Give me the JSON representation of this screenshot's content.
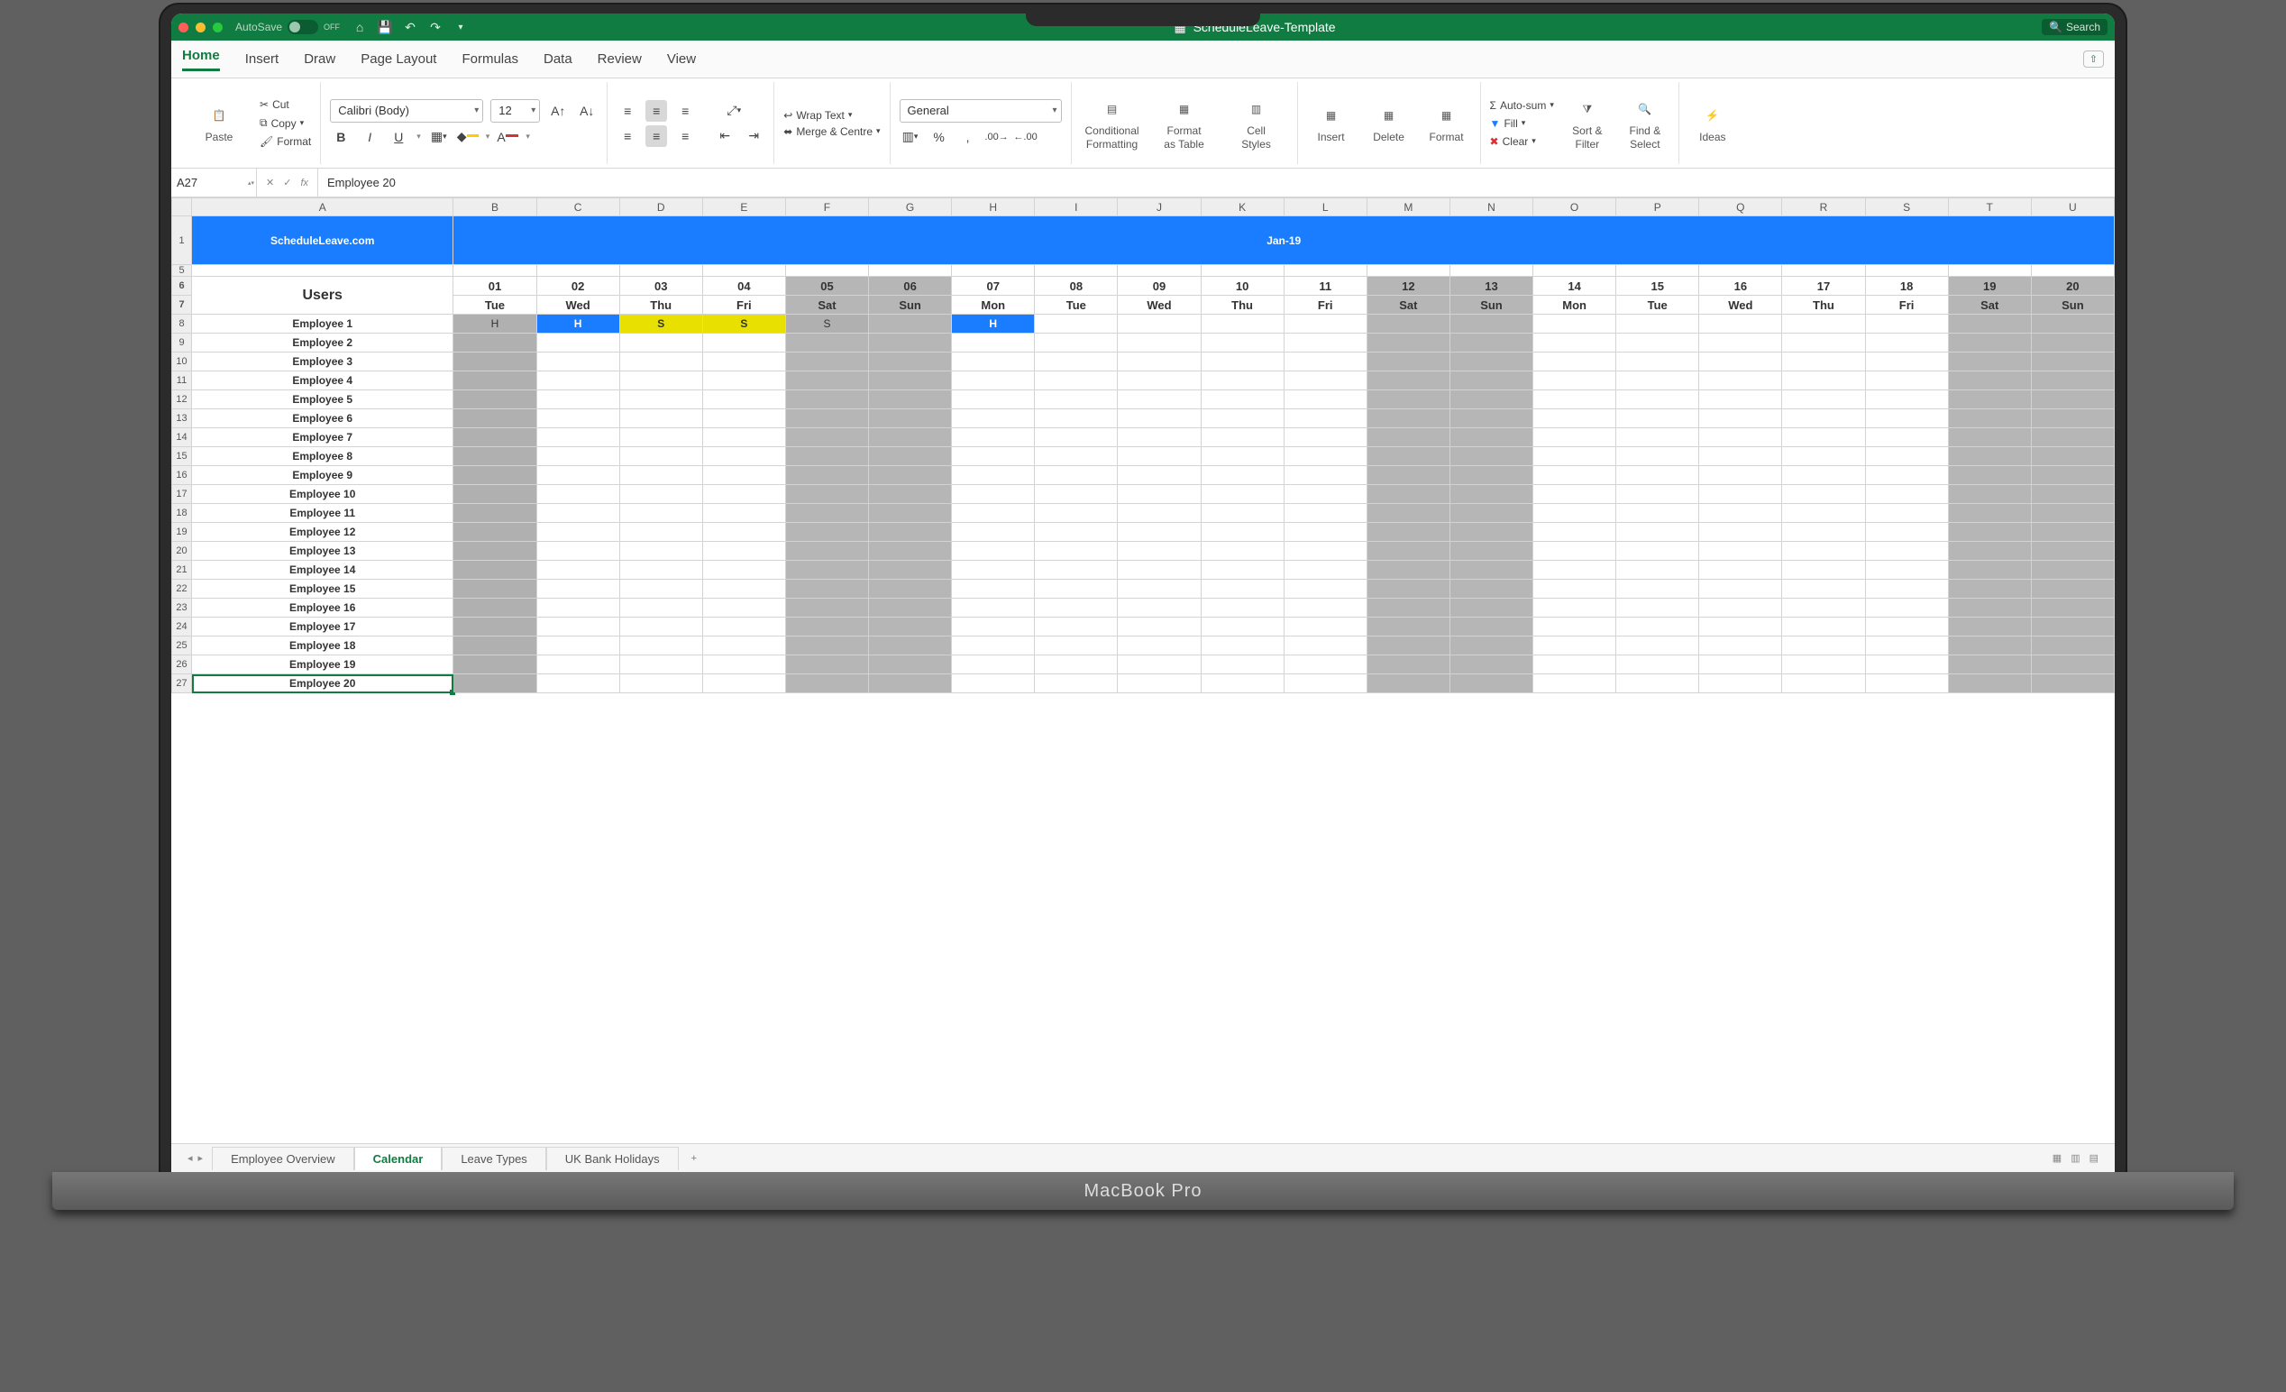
{
  "titlebar": {
    "autosave": "AutoSave",
    "autosave_state": "OFF",
    "doc_title": "ScheduleLeave-Template",
    "search_placeholder": "Search"
  },
  "tabs": [
    "Home",
    "Insert",
    "Draw",
    "Page Layout",
    "Formulas",
    "Data",
    "Review",
    "View"
  ],
  "active_tab": "Home",
  "ribbon": {
    "paste": "Paste",
    "cut": "Cut",
    "copy": "Copy",
    "format": "Format",
    "font_name": "Calibri (Body)",
    "font_size": "12",
    "wrap": "Wrap Text",
    "merge": "Merge & Centre",
    "number_format": "General",
    "cf": "Conditional\nFormatting",
    "fat": "Format\nas Table",
    "cs": "Cell\nStyles",
    "insert": "Insert",
    "delete": "Delete",
    "format2": "Format",
    "autosum": "Auto-sum",
    "fill": "Fill",
    "clear": "Clear",
    "sortfilter": "Sort &\nFilter",
    "findselect": "Find &\nSelect",
    "ideas": "Ideas"
  },
  "fx": {
    "namebox": "A27",
    "formula": "Employee 20"
  },
  "sheet": {
    "columns": [
      "A",
      "B",
      "C",
      "D",
      "E",
      "F",
      "G",
      "H",
      "I",
      "J",
      "K",
      "L",
      "M",
      "N",
      "O",
      "P",
      "Q",
      "R",
      "S",
      "T",
      "U"
    ],
    "title": "ScheduleLeave.com",
    "month": "Jan-19",
    "users_label": "Users",
    "days": [
      {
        "n": "01",
        "d": "Tue",
        "w": false
      },
      {
        "n": "02",
        "d": "Wed",
        "w": false
      },
      {
        "n": "03",
        "d": "Thu",
        "w": false
      },
      {
        "n": "04",
        "d": "Fri",
        "w": false
      },
      {
        "n": "05",
        "d": "Sat",
        "w": true
      },
      {
        "n": "06",
        "d": "Sun",
        "w": true
      },
      {
        "n": "07",
        "d": "Mon",
        "w": false
      },
      {
        "n": "08",
        "d": "Tue",
        "w": false
      },
      {
        "n": "09",
        "d": "Wed",
        "w": false
      },
      {
        "n": "10",
        "d": "Thu",
        "w": false
      },
      {
        "n": "11",
        "d": "Fri",
        "w": false
      },
      {
        "n": "12",
        "d": "Sat",
        "w": true
      },
      {
        "n": "13",
        "d": "Sun",
        "w": true
      },
      {
        "n": "14",
        "d": "Mon",
        "w": false
      },
      {
        "n": "15",
        "d": "Tue",
        "w": false
      },
      {
        "n": "16",
        "d": "Wed",
        "w": false
      },
      {
        "n": "17",
        "d": "Thu",
        "w": false
      },
      {
        "n": "18",
        "d": "Fri",
        "w": false
      },
      {
        "n": "19",
        "d": "Sat",
        "w": true
      },
      {
        "n": "20",
        "d": "Sun",
        "w": true
      }
    ],
    "employees": [
      "Employee 1",
      "Employee 2",
      "Employee 3",
      "Employee 4",
      "Employee 5",
      "Employee 6",
      "Employee 7",
      "Employee 8",
      "Employee 9",
      "Employee 10",
      "Employee 11",
      "Employee 12",
      "Employee 13",
      "Employee 14",
      "Employee 15",
      "Employee 16",
      "Employee 17",
      "Employee 18",
      "Employee 19",
      "Employee 20"
    ],
    "row1_marks": [
      {
        "col": 0,
        "v": "H",
        "cls": "gray"
      },
      {
        "col": 1,
        "v": "H",
        "cls": "blue"
      },
      {
        "col": 2,
        "v": "S",
        "cls": "yellow"
      },
      {
        "col": 3,
        "v": "S",
        "cls": "yellow"
      },
      {
        "col": 4,
        "v": "S",
        "cls": "gray"
      },
      {
        "col": 6,
        "v": "H",
        "cls": "blue"
      }
    ],
    "row_start": 8,
    "selected_row": 27
  },
  "sheet_tabs": {
    "items": [
      "Employee Overview",
      "Calendar",
      "Leave Types",
      "UK Bank Holidays"
    ],
    "active": "Calendar"
  },
  "base_label": "MacBook Pro"
}
